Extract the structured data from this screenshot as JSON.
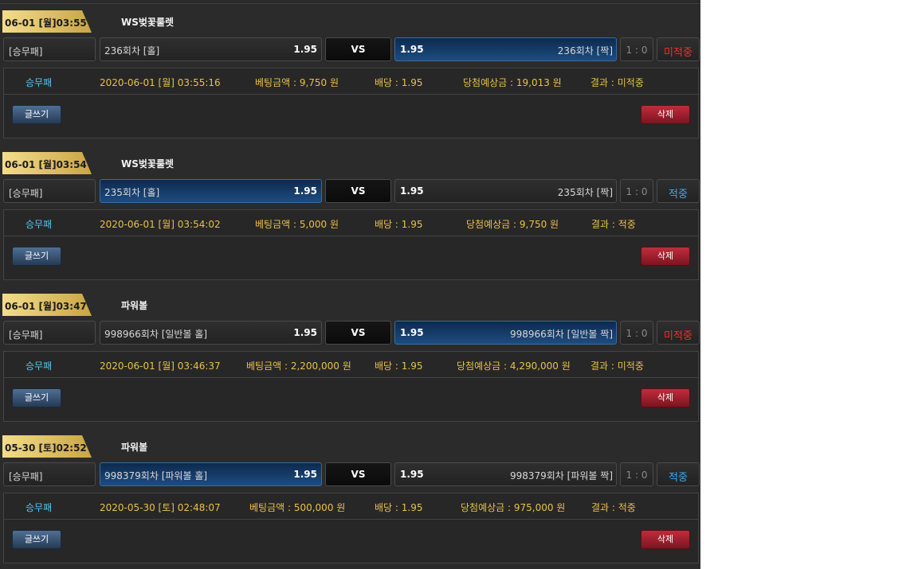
{
  "colors": {
    "panel_bg": "#2b2b2b",
    "gold_tab": "#e9cf7a",
    "selected_bg": "#1e4c80",
    "miss": "#ff2a2a",
    "hit": "#3fa9f5",
    "accent_text": "#e8c14a",
    "type_text": "#5bc6f0"
  },
  "bets": [
    {
      "date_tab": "06-01 [월]03:55",
      "game": "WS벚꽃룰렛",
      "type": "[승무패]",
      "home": {
        "name": "236회차 [홀]",
        "odd": "1.95",
        "selected": false
      },
      "vs": "VS",
      "away": {
        "name": "236회차 [짝]",
        "odd": "1.95",
        "selected": true
      },
      "score": "1 : 0",
      "result": "미적중",
      "result_kind": "miss",
      "detail": {
        "type": "승무패",
        "time": "2020-06-01 [월] 03:55:16",
        "amount": "베팅금액 : 9,750 원",
        "odds": "배당 : 1.95",
        "expected": "당첨예상금 : 19,013 원",
        "result": "결과 : 미적중"
      },
      "write_label": "글쓰기",
      "delete_label": "삭제"
    },
    {
      "date_tab": "06-01 [월]03:54",
      "game": "WS벚꽃룰렛",
      "type": "[승무패]",
      "home": {
        "name": "235회차 [홀]",
        "odd": "1.95",
        "selected": true
      },
      "vs": "VS",
      "away": {
        "name": "235회차 [짝]",
        "odd": "1.95",
        "selected": false
      },
      "score": "1 : 0",
      "result": "적중",
      "result_kind": "hit",
      "detail": {
        "type": "승무패",
        "time": "2020-06-01 [월] 03:54:02",
        "amount": "베팅금액 : 5,000 원",
        "odds": "배당 : 1.95",
        "expected": "당첨예상금 : 9,750 원",
        "result": "결과 : 적중"
      },
      "write_label": "글쓰기",
      "delete_label": "삭제"
    },
    {
      "date_tab": "06-01 [월]03:47",
      "game": "파워볼",
      "type": "[승무패]",
      "home": {
        "name": "998966회차 [일반볼 홀]",
        "odd": "1.95",
        "selected": false
      },
      "vs": "VS",
      "away": {
        "name": "998966회차 [일반볼 짝]",
        "odd": "1.95",
        "selected": true
      },
      "score": "1 : 0",
      "result": "미적중",
      "result_kind": "miss",
      "detail": {
        "type": "승무패",
        "time": "2020-06-01 [월] 03:46:37",
        "amount": "베팅금액 : 2,200,000 원",
        "odds": "배당 : 1.95",
        "expected": "당첨예상금 : 4,290,000 원",
        "result": "결과 : 미적중"
      },
      "write_label": "글쓰기",
      "delete_label": "삭제"
    },
    {
      "date_tab": "05-30 [토]02:52",
      "game": "파워볼",
      "type": "[승무패]",
      "home": {
        "name": "998379회차 [파워볼 홀]",
        "odd": "1.95",
        "selected": true
      },
      "vs": "VS",
      "away": {
        "name": "998379회차 [파워볼 짝]",
        "odd": "1.95",
        "selected": false
      },
      "score": "1 : 0",
      "result": "적중",
      "result_kind": "hit",
      "detail": {
        "type": "승무패",
        "time": "2020-05-30 [토] 02:48:07",
        "amount": "베팅금액 : 500,000 원",
        "odds": "배당 : 1.95",
        "expected": "당첨예상금 : 975,000 원",
        "result": "결과 : 적중"
      },
      "write_label": "글쓰기",
      "delete_label": "삭제"
    }
  ]
}
